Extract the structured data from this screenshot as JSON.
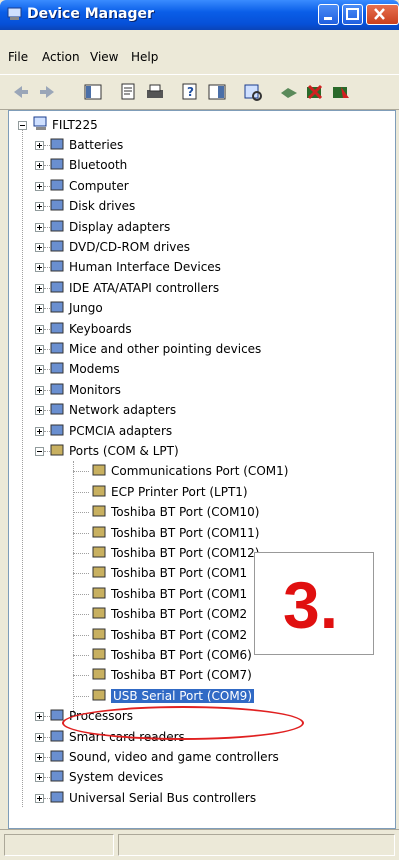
{
  "window": {
    "title": "Device Manager"
  },
  "menu": [
    "File",
    "Action",
    "View",
    "Help"
  ],
  "tree": {
    "root": "FILT225",
    "categories": [
      {
        "label": "Batteries",
        "icon": "battery-icon"
      },
      {
        "label": "Bluetooth",
        "icon": "bluetooth-icon"
      },
      {
        "label": "Computer",
        "icon": "computer-icon"
      },
      {
        "label": "Disk drives",
        "icon": "disk-drive-icon"
      },
      {
        "label": "Display adapters",
        "icon": "display-adapter-icon"
      },
      {
        "label": "DVD/CD-ROM drives",
        "icon": "dvd-drive-icon"
      },
      {
        "label": "Human Interface Devices",
        "icon": "hid-icon"
      },
      {
        "label": "IDE ATA/ATAPI controllers",
        "icon": "ide-controller-icon"
      },
      {
        "label": "Jungo",
        "icon": "jungo-icon"
      },
      {
        "label": "Keyboards",
        "icon": "keyboard-icon"
      },
      {
        "label": "Mice and other pointing devices",
        "icon": "mouse-icon"
      },
      {
        "label": "Modems",
        "icon": "modem-icon"
      },
      {
        "label": "Monitors",
        "icon": "monitor-icon"
      },
      {
        "label": "Network adapters",
        "icon": "network-adapter-icon"
      },
      {
        "label": "PCMCIA adapters",
        "icon": "pcmcia-icon"
      },
      {
        "label": "Ports (COM & LPT)",
        "icon": "port-icon"
      }
    ],
    "ports": [
      "Communications Port (COM1)",
      "ECP Printer Port (LPT1)",
      "Toshiba BT Port (COM10)",
      "Toshiba BT Port (COM11)",
      "Toshiba BT Port (COM12)",
      "Toshiba BT Port (COM1",
      "Toshiba BT Port (COM1",
      "Toshiba BT Port (COM2",
      "Toshiba BT Port (COM2",
      "Toshiba BT Port (COM6)",
      "Toshiba BT Port (COM7)",
      "USB Serial Port (COM9)"
    ],
    "after": [
      {
        "label": "Processors",
        "icon": "processor-icon"
      },
      {
        "label": "Smart card readers",
        "icon": "smart-card-icon"
      },
      {
        "label": "Sound, video and game controllers",
        "icon": "sound-icon"
      },
      {
        "label": "System devices",
        "icon": "system-device-icon"
      },
      {
        "label": "Universal Serial Bus controllers",
        "icon": "usb-icon"
      }
    ]
  },
  "callout": {
    "text": "3."
  },
  "colors": {
    "highlight": "#e02020",
    "selection": "#316ac5"
  }
}
